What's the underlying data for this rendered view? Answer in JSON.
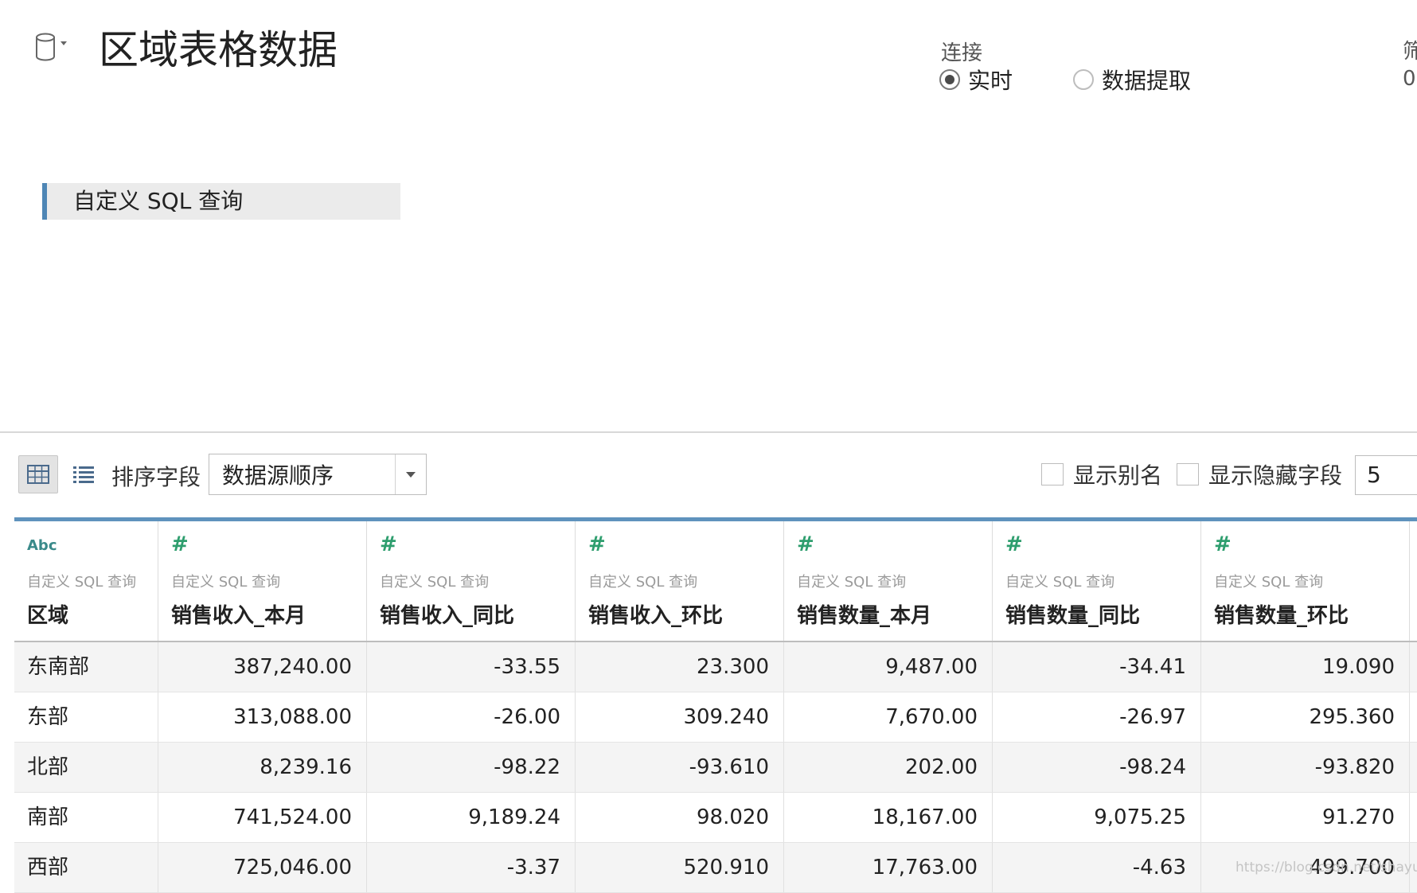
{
  "header": {
    "title": "区域表格数据",
    "connection_label": "连接",
    "connection_options": [
      {
        "label": "实时",
        "selected": true
      },
      {
        "label": "数据提取",
        "selected": false
      }
    ],
    "edge_label": "筛",
    "edge_value": "0"
  },
  "canvas": {
    "table_label": "自定义 SQL 查询"
  },
  "toolbar": {
    "sort_label": "排序字段",
    "sort_value": "数据源顺序",
    "show_alias_label": "显示别名",
    "show_hidden_label": "显示隐藏字段",
    "rows_value": "5"
  },
  "grid": {
    "columns": [
      {
        "type": "Abc",
        "source": "自定义 SQL 查询",
        "name": "区域"
      },
      {
        "type": "#",
        "source": "自定义 SQL 查询",
        "name": "销售收入_本月"
      },
      {
        "type": "#",
        "source": "自定义 SQL 查询",
        "name": "销售收入_同比"
      },
      {
        "type": "#",
        "source": "自定义 SQL 查询",
        "name": "销售收入_环比"
      },
      {
        "type": "#",
        "source": "自定义 SQL 查询",
        "name": "销售数量_本月"
      },
      {
        "type": "#",
        "source": "自定义 SQL 查询",
        "name": "销售数量_同比"
      },
      {
        "type": "#",
        "source": "自定义 SQL 查询",
        "name": "销售数量_环比"
      }
    ],
    "rows": [
      [
        "东南部",
        "387,240.00",
        "-33.55",
        "23.300",
        "9,487.00",
        "-34.41",
        "19.090"
      ],
      [
        "东部",
        "313,088.00",
        "-26.00",
        "309.240",
        "7,670.00",
        "-26.97",
        "295.360"
      ],
      [
        "北部",
        "8,239.16",
        "-98.22",
        "-93.610",
        "202.00",
        "-98.24",
        "-93.820"
      ],
      [
        "南部",
        "741,524.00",
        "9,189.24",
        "98.020",
        "18,167.00",
        "9,075.25",
        "91.270"
      ],
      [
        "西部",
        "725,046.00",
        "-3.37",
        "520.910",
        "17,763.00",
        "-4.63",
        "499.700"
      ]
    ]
  },
  "watermark": "https://blog.csdn.net/shayuwei"
}
